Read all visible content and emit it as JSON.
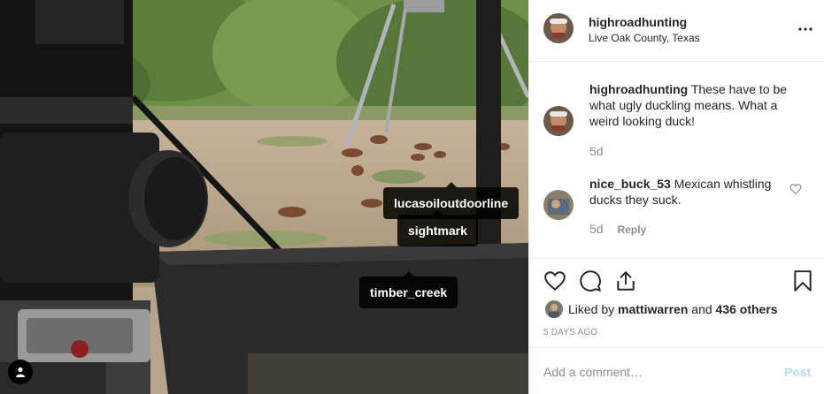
{
  "post": {
    "username": "highroadhunting",
    "location": "Live Oak County, Texas"
  },
  "photo_tags": [
    {
      "label": "lucasoiloutdoorline"
    },
    {
      "label": "sightmark"
    },
    {
      "label": "timber_creek"
    }
  ],
  "comments": [
    {
      "username": "highroadhunting",
      "text": "These have to be what ugly duckling means. What a weird looking duck!",
      "age": "5d",
      "reply": ""
    },
    {
      "username": "nice_buck_53",
      "text": "Mexican whistling ducks they suck.",
      "age": "5d",
      "reply": "Reply"
    }
  ],
  "likes": {
    "prefix": "Liked by",
    "user": "mattiwarren",
    "connector": "and",
    "others": "436 others"
  },
  "timestamp": "5 DAYS AGO",
  "add_comment": {
    "placeholder": "Add a comment…",
    "post_label": "Post"
  },
  "icons": {
    "more": "more-horizontal-icon",
    "like": "heart-icon",
    "comment": "comment-bubble-icon",
    "share": "share-icon",
    "save": "bookmark-icon",
    "user_tags": "user-icon"
  },
  "colors": {
    "accent_link": "#0095f6",
    "post_disabled": "#b3dbff",
    "muted_text": "#8e8e8e",
    "border": "#efefef"
  }
}
